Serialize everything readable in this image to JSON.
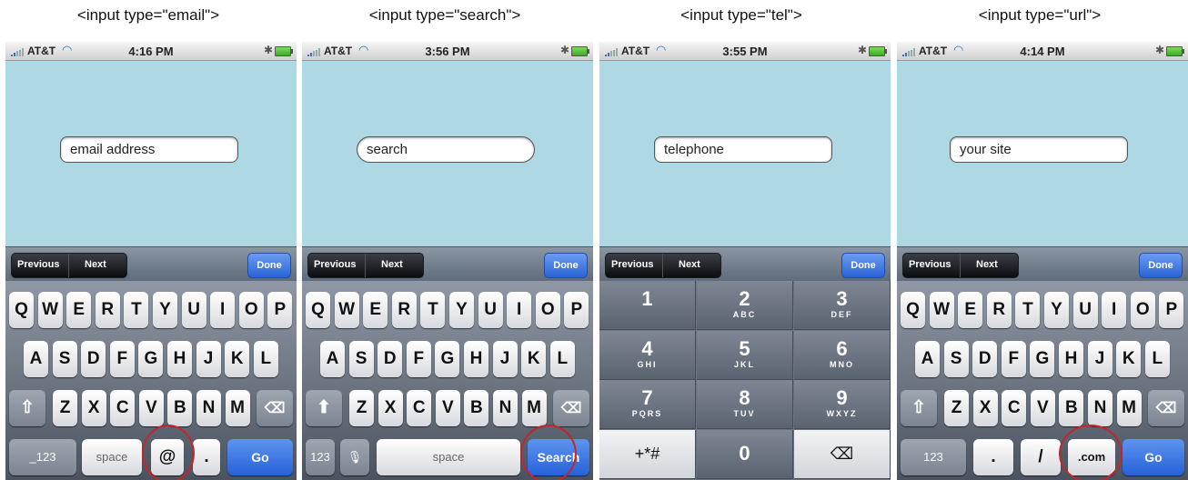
{
  "captions": [
    "<input type=\"email\">",
    "<input type=\"search\">",
    "<input type=\"tel\">",
    "<input type=\"url\">"
  ],
  "phones": [
    {
      "carrier": "AT&T",
      "time": "4:16 PM",
      "field_value": "email address",
      "previous_label": "Previous",
      "next_label": "Next",
      "done_label": "Done",
      "row1": [
        "Q",
        "W",
        "E",
        "R",
        "T",
        "Y",
        "U",
        "I",
        "O",
        "P"
      ],
      "row2": [
        "A",
        "S",
        "D",
        "F",
        "G",
        "H",
        "J",
        "K",
        "L"
      ],
      "row3": [
        "Z",
        "X",
        "C",
        "V",
        "B",
        "N",
        "M"
      ],
      "bottom": {
        "k1": "_123",
        "k2": "space",
        "k3": "@",
        "k4": ".",
        "k5": "Go"
      }
    },
    {
      "carrier": "AT&T",
      "time": "3:56 PM",
      "field_value": "search",
      "previous_label": "Previous",
      "next_label": "Next",
      "done_label": "Done",
      "row1": [
        "Q",
        "W",
        "E",
        "R",
        "T",
        "Y",
        "U",
        "I",
        "O",
        "P"
      ],
      "row2": [
        "A",
        "S",
        "D",
        "F",
        "G",
        "H",
        "J",
        "K",
        "L"
      ],
      "row3": [
        "Z",
        "X",
        "C",
        "V",
        "B",
        "N",
        "M"
      ],
      "bottom": {
        "k1": "123",
        "k2": "space",
        "k3": "Search"
      }
    },
    {
      "carrier": "AT&T",
      "time": "3:55 PM",
      "field_value": "telephone",
      "previous_label": "Previous",
      "next_label": "Next",
      "done_label": "Done",
      "numpad": [
        {
          "d": "1",
          "l": ""
        },
        {
          "d": "2",
          "l": "ABC"
        },
        {
          "d": "3",
          "l": "DEF"
        },
        {
          "d": "4",
          "l": "GHI"
        },
        {
          "d": "5",
          "l": "JKL"
        },
        {
          "d": "6",
          "l": "MNO"
        },
        {
          "d": "7",
          "l": "PQRS"
        },
        {
          "d": "8",
          "l": "TUV"
        },
        {
          "d": "9",
          "l": "WXYZ"
        },
        {
          "d": "+*#",
          "l": ""
        },
        {
          "d": "0",
          "l": ""
        },
        {
          "d": "⌫",
          "l": ""
        }
      ]
    },
    {
      "carrier": "AT&T",
      "time": "4:14 PM",
      "field_value": "your site",
      "previous_label": "Previous",
      "next_label": "Next",
      "done_label": "Done",
      "row1": [
        "Q",
        "W",
        "E",
        "R",
        "T",
        "Y",
        "U",
        "I",
        "O",
        "P"
      ],
      "row2": [
        "A",
        "S",
        "D",
        "F",
        "G",
        "H",
        "J",
        "K",
        "L"
      ],
      "row3": [
        "Z",
        "X",
        "C",
        "V",
        "B",
        "N",
        "M"
      ],
      "bottom": {
        "k1": "123",
        "k2": ".",
        "k3": "/",
        "k4": ".com",
        "k5": "Go"
      }
    }
  ],
  "colors": {
    "screen_bg": "#add8e4",
    "highlight_circle": "#c4262a",
    "action_key": "#2762d8"
  }
}
